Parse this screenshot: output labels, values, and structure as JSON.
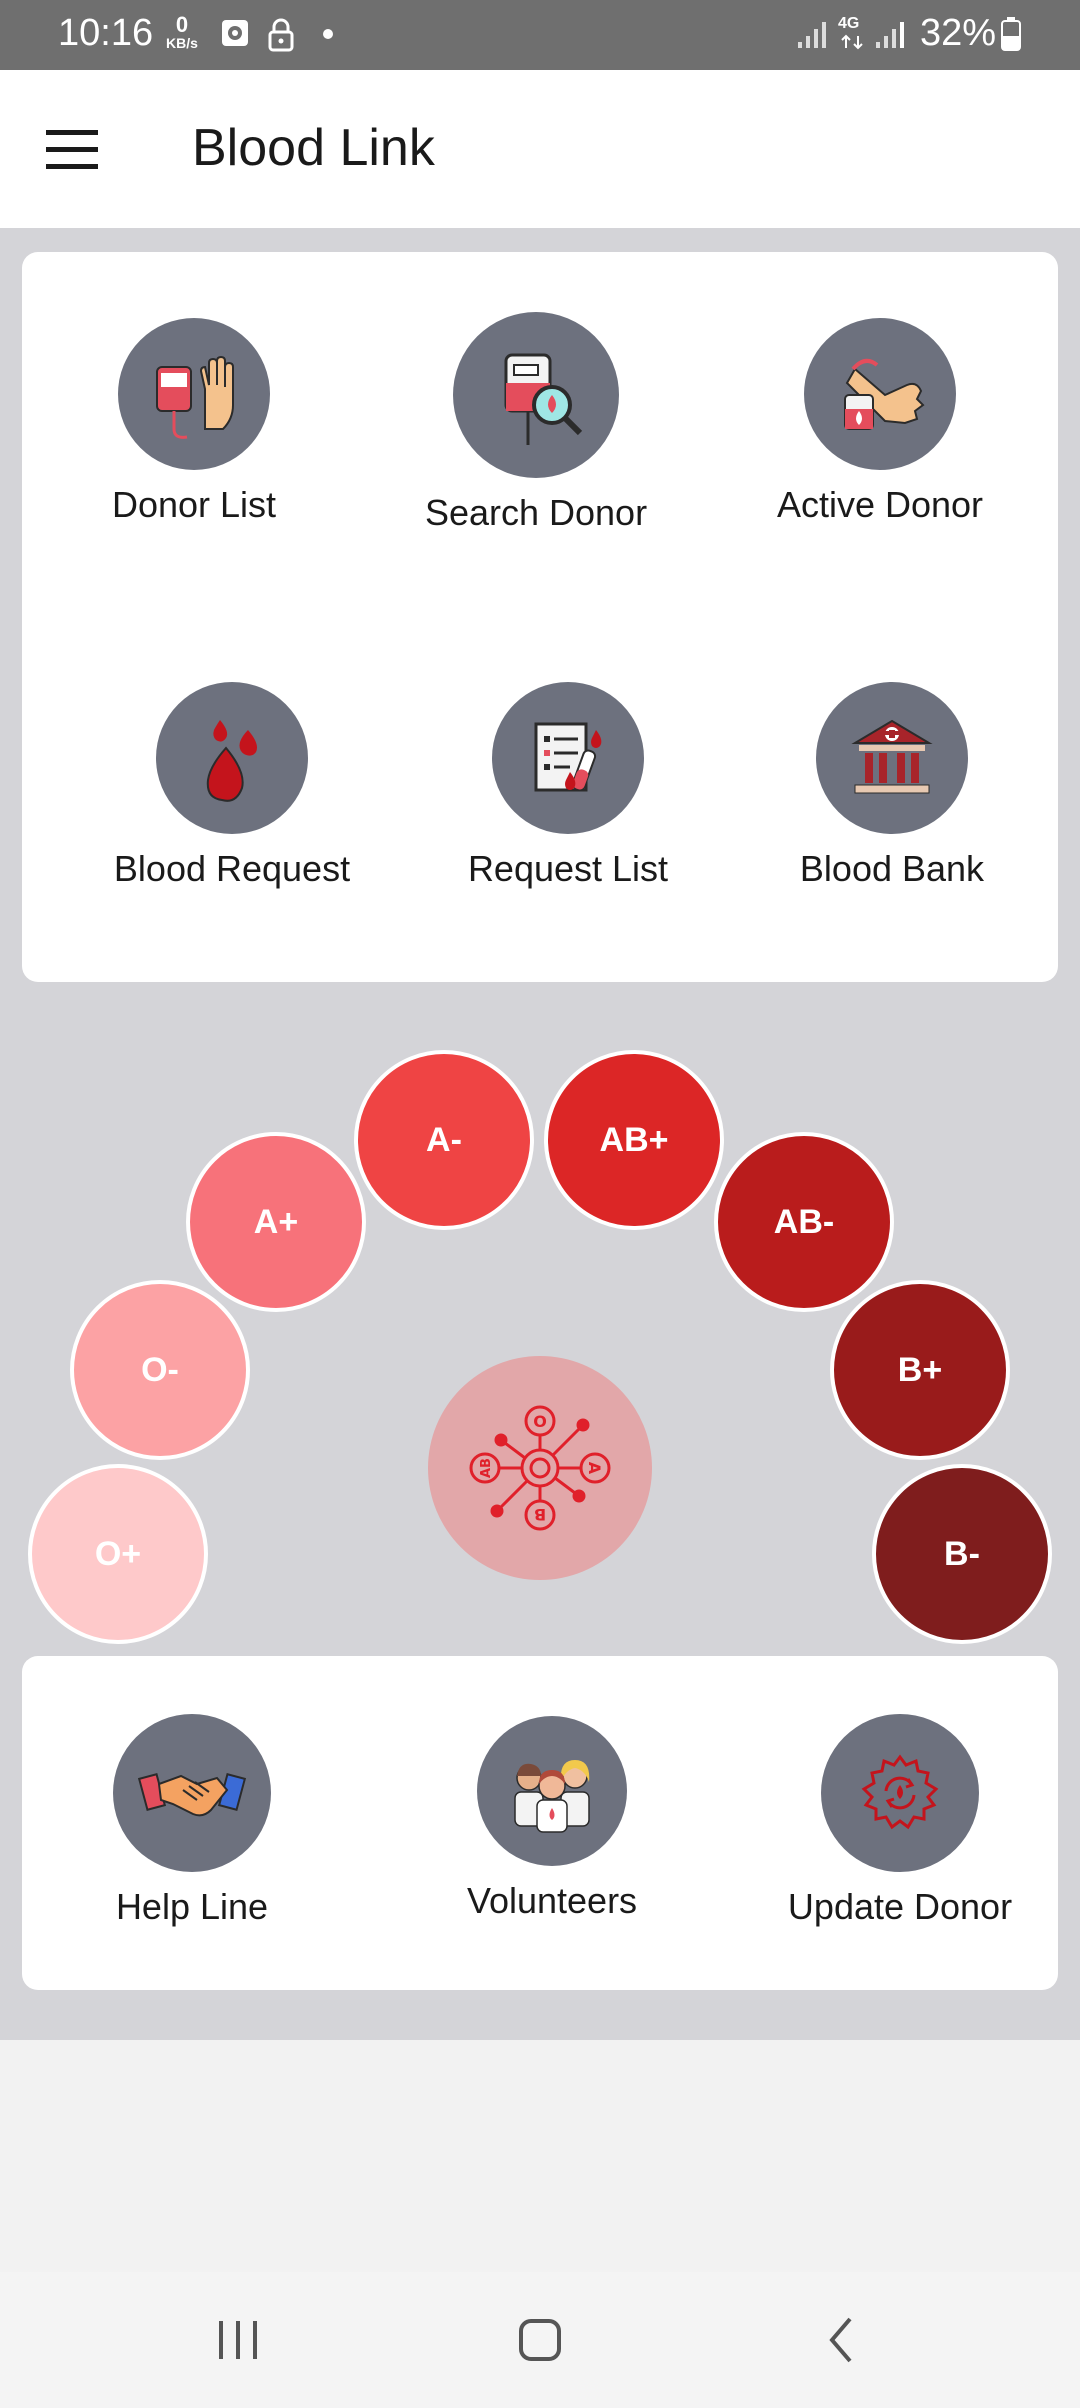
{
  "status_bar": {
    "time": "10:16",
    "net_speed_value": "0",
    "net_speed_unit": "KB/s",
    "network_type": "4G",
    "battery": "32%"
  },
  "app_bar": {
    "title": "Blood Link",
    "menu_icon": "hamburger-menu-icon"
  },
  "main_menu": [
    {
      "label": "Donor List",
      "icon": "donor-list-icon"
    },
    {
      "label": "Search Donor",
      "icon": "search-donor-icon"
    },
    {
      "label": "Active Donor",
      "icon": "active-donor-icon"
    },
    {
      "label": "Blood Request",
      "icon": "blood-drops-icon"
    },
    {
      "label": "Request List",
      "icon": "request-list-icon"
    },
    {
      "label": "Blood Bank",
      "icon": "blood-bank-icon"
    }
  ],
  "blood_groups": [
    {
      "label": "O+",
      "color": "#fec9ca"
    },
    {
      "label": "O-",
      "color": "#fca2a4"
    },
    {
      "label": "A+",
      "color": "#f7727a"
    },
    {
      "label": "A-",
      "color": "#ef4444"
    },
    {
      "label": "AB+",
      "color": "#dc2626"
    },
    {
      "label": "AB-",
      "color": "#b91c1c"
    },
    {
      "label": "B+",
      "color": "#991b1b"
    },
    {
      "label": "B-",
      "color": "#7f1d1d"
    }
  ],
  "hub": {
    "icon": "blood-group-network-icon",
    "labels": [
      "O",
      "A",
      "AB",
      "B"
    ]
  },
  "bottom_menu": [
    {
      "label": "Help Line",
      "icon": "handshake-icon"
    },
    {
      "label": "Volunteers",
      "icon": "volunteers-icon"
    },
    {
      "label": "Update Donor",
      "icon": "update-donor-icon"
    }
  ],
  "colors": {
    "accent": "#dc2626",
    "icon_circle": "#6d717e",
    "background": "#d4d4d8"
  }
}
